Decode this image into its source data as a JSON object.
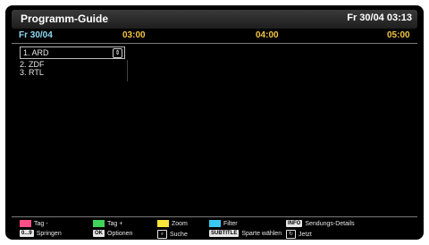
{
  "header": {
    "title": "Programm-Guide",
    "datetime": "Fr 30/04 03:13"
  },
  "timeline": {
    "date": "Fr 30/04",
    "times": [
      "03:00",
      "04:00",
      "05:00"
    ]
  },
  "channels": [
    "1. ARD",
    "2. ZDF",
    "3. RTL"
  ],
  "legend": {
    "red": "Tag -",
    "green": "Tag +",
    "yellow": "Zoom",
    "blue": "Filter",
    "info_key": "INFO",
    "info_label": "Sendungs-Details",
    "num_key": "0...9",
    "num_label": "Springen",
    "ok_key": "OK",
    "ok_label": "Optionen",
    "search_label": "Suche",
    "subtitle_key": "SUBTITLE",
    "subtitle_label": "Sparte wählen",
    "now_label": "Jetzt"
  },
  "colors": {
    "red": "#ff4f86",
    "green": "#3fd35a",
    "yellow": "#f7e53b",
    "blue": "#39c8f0",
    "accent_date": "#8fd9f3",
    "accent_time": "#f4c542"
  }
}
